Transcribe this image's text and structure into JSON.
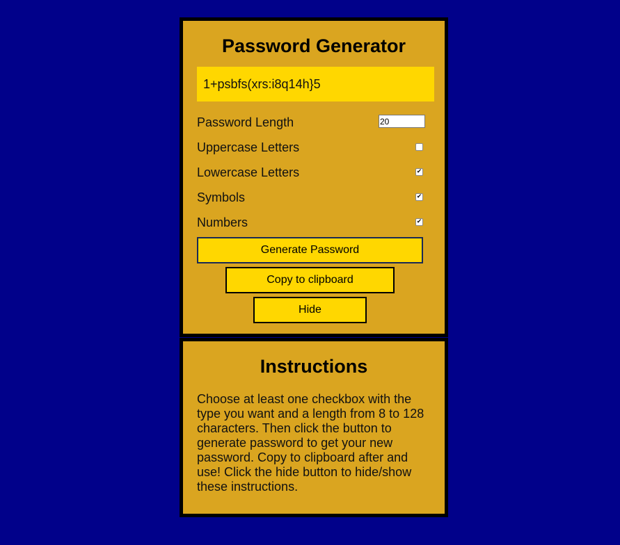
{
  "generator": {
    "title": "Password Generator",
    "password": "1+psbfs(xrs:i8q14h}5",
    "options": [
      {
        "label": "Password Length",
        "type": "number",
        "value": "20"
      },
      {
        "label": "Uppercase Letters",
        "type": "checkbox",
        "checked": false
      },
      {
        "label": "Lowercase Letters",
        "type": "checkbox",
        "checked": true
      },
      {
        "label": "Symbols",
        "type": "checkbox",
        "checked": true
      },
      {
        "label": "Numbers",
        "type": "checkbox",
        "checked": true
      }
    ],
    "buttons": {
      "generate": "Generate Password",
      "copy": "Copy to clipboard",
      "hide": "Hide"
    }
  },
  "instructions": {
    "title": "Instructions",
    "text": "Choose at least one checkbox with the type you want and a length from 8 to 128 characters. Then click the button to generate password to get your new password. Copy to clipboard after and use! Click the hide button to hide/show these instructions."
  },
  "colors": {
    "background": "#01018a",
    "panel": "#daa520",
    "accent": "#ffd700",
    "border": "#000000"
  }
}
